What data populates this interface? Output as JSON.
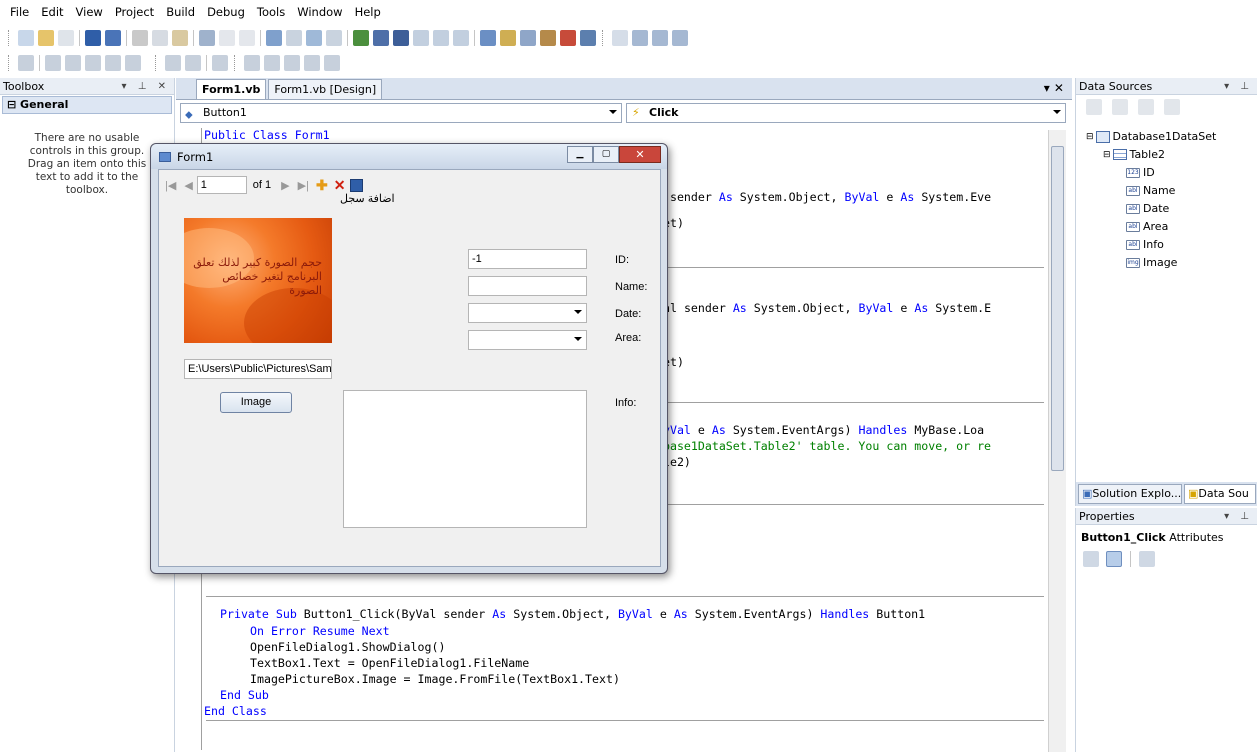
{
  "menu": [
    "File",
    "Edit",
    "View",
    "Project",
    "Build",
    "Debug",
    "Tools",
    "Window",
    "Help"
  ],
  "toolbox": {
    "title": "Toolbox",
    "group": "General",
    "empty_message": "There are no usable controls in this group. Drag an item onto this text to add it to the toolbox."
  },
  "editor": {
    "tabs": [
      "Form1.vb",
      "Form1.vb [Design]"
    ],
    "object_dropdown": "Button1",
    "event_dropdown": "Click",
    "code_lines": [
      "Public Class Form1",
      "1 sender As System.Object, ByVal e As System.Eve",
      "Set)",
      "Val sender As System.Object, ByVal e As System.E",
      "Set)",
      "ByVal e As System.EventArgs) Handles MyBase.Loa",
      "abase1DataSet.Table2' table. You can move, or re",
      "ble2)",
      "Private Sub Button1_Click(ByVal sender As System.Object, ByVal e As System.EventArgs) Handles Button1",
      "On Error Resume Next",
      "OpenFileDialog1.ShowDialog()",
      "TextBox1.Text = OpenFileDialog1.FileName",
      "ImagePictureBox.Image = Image.FromFile(TextBox1.Text)",
      "End Sub",
      "End Class"
    ]
  },
  "form": {
    "title": "Form1",
    "nav_position": "1",
    "nav_count": "of 1",
    "add_record_label": "اضافة سجل",
    "picture_caption": "حجم الصورة كبير لذلك تعلق البرنامج لتغير خصائص الصورة",
    "path_value": "E:\\Users\\Public\\Pictures\\Sam",
    "image_button": "Image",
    "id_value": "-1",
    "labels": {
      "id": "ID:",
      "name": "Name:",
      "date": "Date:",
      "area": "Area:",
      "info": "Info:"
    }
  },
  "data_sources": {
    "title": "Data Sources",
    "dataset": "Database1DataSet",
    "table": "Table2",
    "fields": [
      {
        "name": "ID",
        "icon": "123"
      },
      {
        "name": "Name",
        "icon": "abl"
      },
      {
        "name": "Date",
        "icon": "abl"
      },
      {
        "name": "Area",
        "icon": "abl"
      },
      {
        "name": "Info",
        "icon": "abl"
      },
      {
        "name": "Image",
        "icon": "img"
      }
    ],
    "bottom_tabs": [
      "Solution Explo...",
      "Data Sou"
    ]
  },
  "properties": {
    "title": "Properties",
    "selected_name": "Button1_Click",
    "selected_type": "Attributes"
  },
  "colors": {
    "keyword": "#0000ff",
    "string": "#a31515",
    "panel_header": "#e9eef5",
    "form_chrome": "#d6dfea"
  }
}
